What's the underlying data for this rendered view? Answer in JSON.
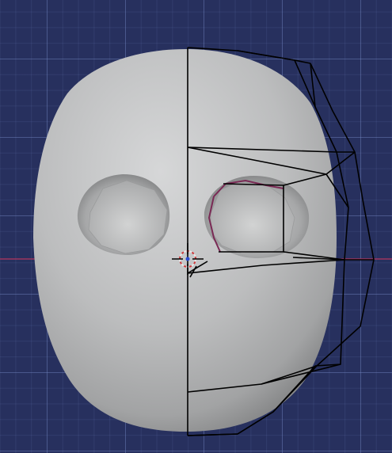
{
  "viewport": {
    "mode": "edit-mesh",
    "background_color": "#27305e",
    "grid_color": "#5a6cb4",
    "x_axis_color": "#b5365e"
  },
  "mesh": {
    "object": "head",
    "surface_color": "#bfc1c2",
    "cage_wire_color": "#000000",
    "selected_edge_color": "#7a2a55"
  },
  "cursor": {
    "icon": "3d-cursor-icon"
  }
}
